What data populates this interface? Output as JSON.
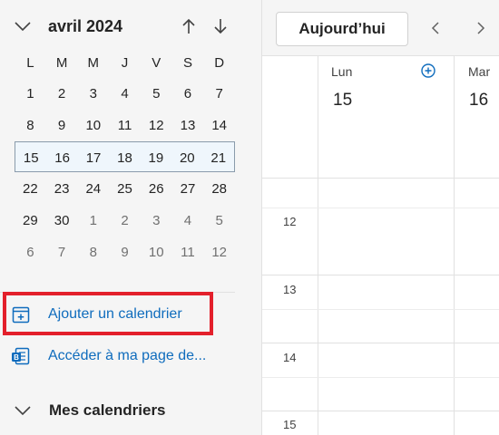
{
  "mini_calendar": {
    "month_title": "avril 2024",
    "weekdays": [
      "L",
      "M",
      "M",
      "J",
      "V",
      "S",
      "D"
    ],
    "weeks": [
      [
        "1",
        "2",
        "3",
        "4",
        "5",
        "6",
        "7"
      ],
      [
        "8",
        "9",
        "10",
        "11",
        "12",
        "13",
        "14"
      ],
      [
        "15",
        "16",
        "17",
        "18",
        "19",
        "20",
        "21"
      ],
      [
        "22",
        "23",
        "24",
        "25",
        "26",
        "27",
        "28"
      ],
      [
        "29",
        "30",
        "1",
        "2",
        "3",
        "4",
        "5"
      ],
      [
        "6",
        "7",
        "8",
        "9",
        "10",
        "11",
        "12"
      ]
    ],
    "current_week_index": 2
  },
  "actions": {
    "add_calendar": "Ajouter un calendrier",
    "goto_page": "Accéder à ma page de..."
  },
  "my_calendars": {
    "label": "Mes calendriers"
  },
  "toolbar": {
    "today_label": "Aujourd’hui"
  },
  "day_columns": [
    {
      "name": "Lun",
      "number": "15"
    },
    {
      "name": "Mar",
      "number": "16"
    }
  ],
  "hours": [
    "12",
    "13",
    "14",
    "15"
  ],
  "colors": {
    "accent": "#0f6cbd",
    "highlight_box": "#e3202b",
    "current_week_bg": "#eff6fc"
  }
}
